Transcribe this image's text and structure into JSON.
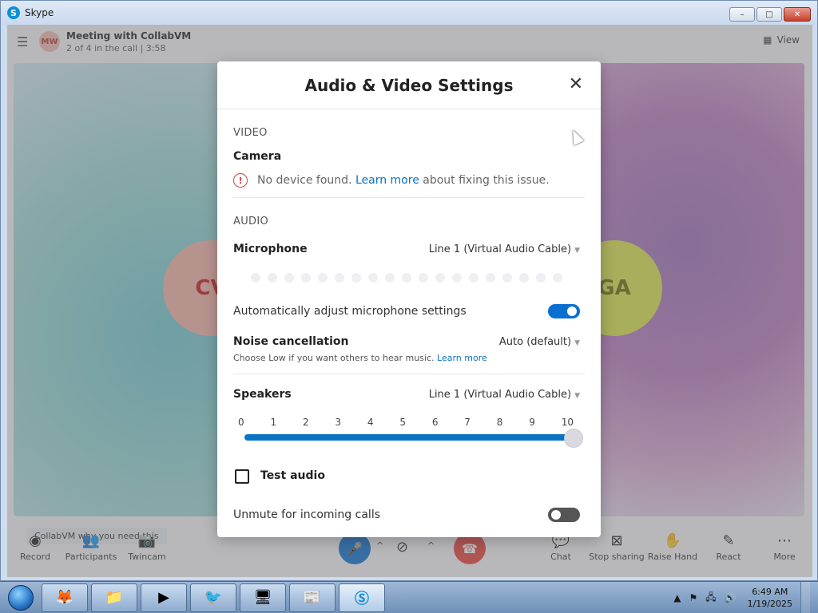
{
  "window": {
    "title": "Skype",
    "minimize": "–",
    "maximize": "□",
    "close": "✕"
  },
  "call": {
    "avatar_initials": "MW",
    "title": "Meeting with CollabVM",
    "subtitle": "2 of 4 in the call | 3:58",
    "view_label": "View",
    "participant_left": "CV",
    "participant_right": "GA",
    "hint": "CollabVM why you need this"
  },
  "toolbar": {
    "record": "Record",
    "participants": "Participants",
    "twincam": "Twincam",
    "chat": "Chat",
    "stop_sharing": "Stop sharing",
    "raise_hand": "Raise Hand",
    "react": "React",
    "more": "More"
  },
  "dialog": {
    "title": "Audio & Video Settings",
    "video_section": "VIDEO",
    "camera_label": "Camera",
    "camera_warning_prefix": "No device found.",
    "camera_warning_link": "Learn more",
    "camera_warning_suffix": "about fixing this issue.",
    "audio_section": "AUDIO",
    "microphone_label": "Microphone",
    "microphone_value": "Line 1 (Virtual Audio Cable)",
    "auto_adjust_label": "Automatically adjust microphone settings",
    "auto_adjust_on": true,
    "noise_label": "Noise cancellation",
    "noise_value": "Auto (default)",
    "noise_hint": "Choose Low if you want others to hear music.",
    "noise_hint_link": "Learn more",
    "speakers_label": "Speakers",
    "speakers_value": "Line 1 (Virtual Audio Cable)",
    "volume_ticks": [
      "0",
      "1",
      "2",
      "3",
      "4",
      "5",
      "6",
      "7",
      "8",
      "9",
      "10"
    ],
    "volume_value": 10,
    "test_audio_label": "Test audio",
    "unmute_label": "Unmute for incoming calls",
    "unmute_on": false
  },
  "taskbar": {
    "time": "6:49 AM",
    "date": "1/19/2025"
  },
  "colors": {
    "accent": "#0a6fd1",
    "link": "#0a73c4",
    "end_call": "#e5413b",
    "warning": "#d0443c"
  }
}
